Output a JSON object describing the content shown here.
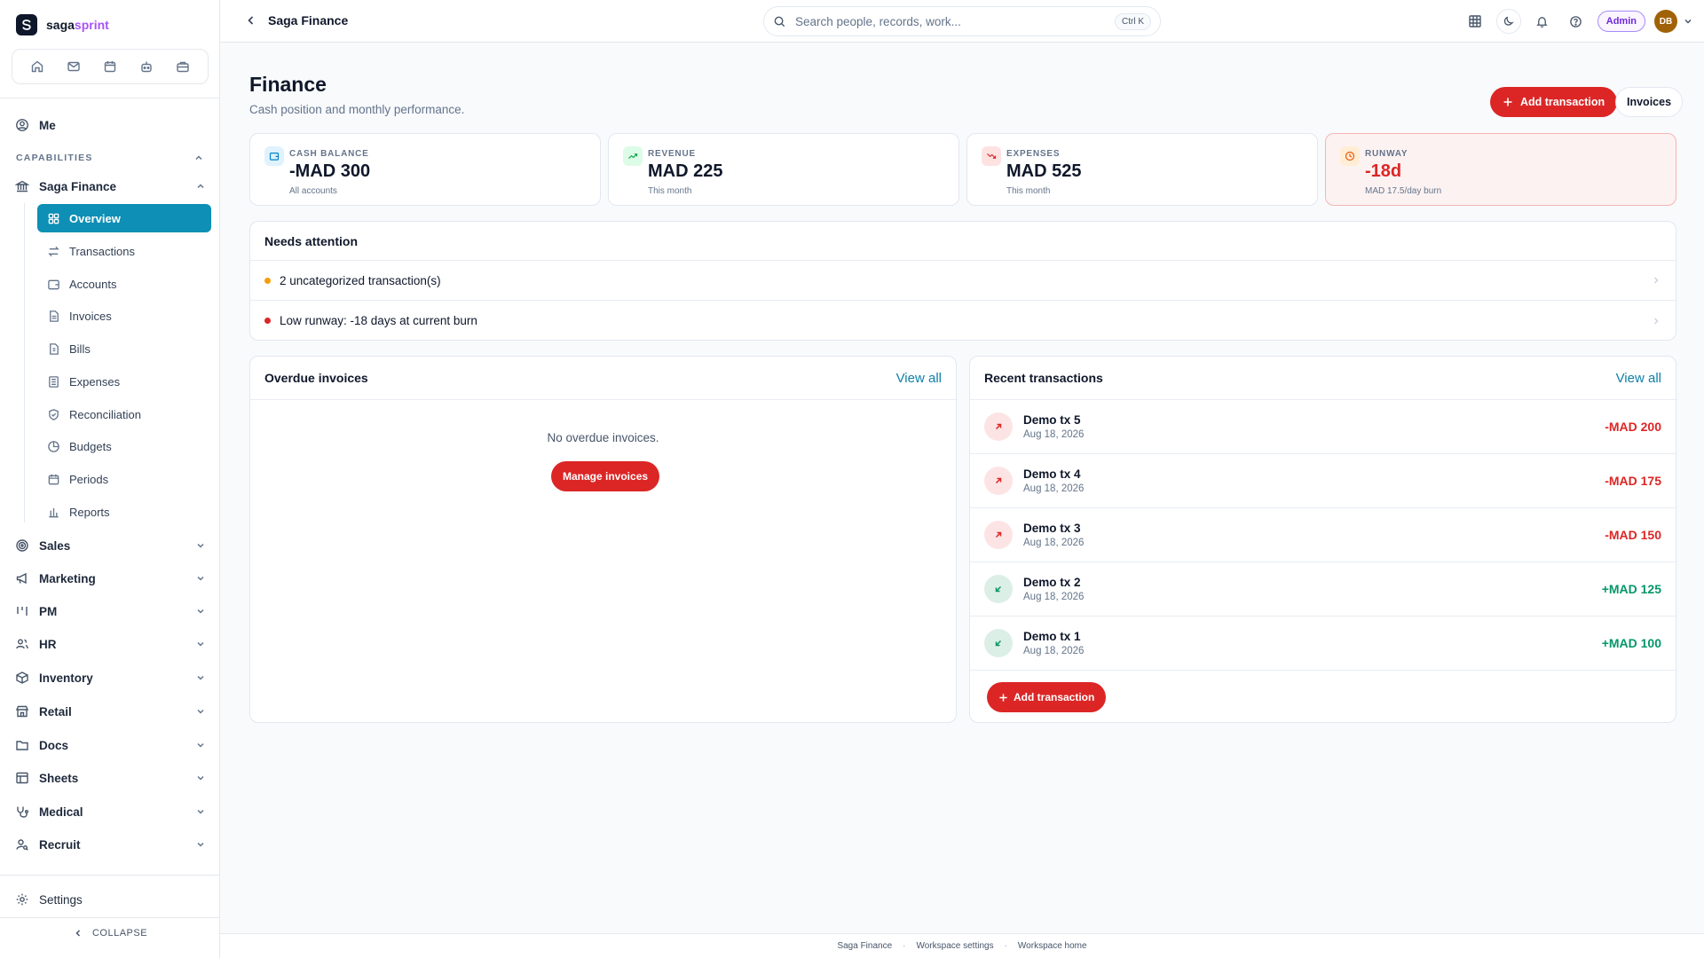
{
  "brand": {
    "name_main": "saga",
    "name_accent": "sprint"
  },
  "sidebar": {
    "me": "Me",
    "capabilities_label": "CAPABILITIES",
    "section": "Saga Finance",
    "sub_items": [
      {
        "label": "Overview",
        "icon": "grid-icon",
        "active": true
      },
      {
        "label": "Transactions",
        "icon": "arrows-swap-icon"
      },
      {
        "label": "Accounts",
        "icon": "wallet-icon"
      },
      {
        "label": "Invoices",
        "icon": "document-icon"
      },
      {
        "label": "Bills",
        "icon": "receipt-icon"
      },
      {
        "label": "Expenses",
        "icon": "list-icon"
      },
      {
        "label": "Reconciliation",
        "icon": "shield-check-icon"
      },
      {
        "label": "Budgets",
        "icon": "pie-icon"
      },
      {
        "label": "Periods",
        "icon": "calendar-icon"
      },
      {
        "label": "Reports",
        "icon": "bar-chart-icon"
      }
    ],
    "groups": [
      {
        "label": "Sales",
        "icon": "target-icon"
      },
      {
        "label": "Marketing",
        "icon": "megaphone-icon"
      },
      {
        "label": "PM",
        "icon": "kanban-icon"
      },
      {
        "label": "HR",
        "icon": "users-icon"
      },
      {
        "label": "Inventory",
        "icon": "box-icon"
      },
      {
        "label": "Retail",
        "icon": "store-icon"
      },
      {
        "label": "Docs",
        "icon": "folder-icon"
      },
      {
        "label": "Sheets",
        "icon": "table-icon"
      },
      {
        "label": "Medical",
        "icon": "stethoscope-icon"
      },
      {
        "label": "Recruit",
        "icon": "user-search-icon"
      }
    ],
    "settings": "Settings",
    "collapse": "COLLAPSE"
  },
  "topbar": {
    "breadcrumb": "Saga Finance",
    "search_placeholder": "Search people, records, work...",
    "search_shortcut": "Ctrl K",
    "role_badge": "Admin",
    "avatar_initials": "DB"
  },
  "page": {
    "title": "Finance",
    "subtitle": "Cash position and monthly performance.",
    "add_transaction": "Add transaction",
    "invoices": "Invoices"
  },
  "kpis": [
    {
      "label": "CASH BALANCE",
      "value": "-MAD 300",
      "note": "All accounts"
    },
    {
      "label": "REVENUE",
      "value": "MAD 225",
      "note": "This month"
    },
    {
      "label": "EXPENSES",
      "value": "MAD 525",
      "note": "This month"
    },
    {
      "label": "RUNWAY",
      "value": "-18d",
      "note": "MAD 17.5/day burn"
    }
  ],
  "attention": {
    "title": "Needs attention",
    "items": [
      {
        "text": "2 uncategorized transaction(s)",
        "color": "#f59e0b"
      },
      {
        "text": "Low runway: -18 days at current burn",
        "color": "#dc2626"
      }
    ]
  },
  "overdue": {
    "title": "Overdue invoices",
    "view_all": "View all",
    "empty": "No overdue invoices.",
    "manage": "Manage invoices"
  },
  "recent": {
    "title": "Recent transactions",
    "view_all": "View all",
    "rows": [
      {
        "name": "Demo tx 5",
        "date": "Aug 18, 2026",
        "amount": "-MAD 200",
        "direction": "out"
      },
      {
        "name": "Demo tx 4",
        "date": "Aug 18, 2026",
        "amount": "-MAD 175",
        "direction": "out"
      },
      {
        "name": "Demo tx 3",
        "date": "Aug 18, 2026",
        "amount": "-MAD 150",
        "direction": "out"
      },
      {
        "name": "Demo tx 2",
        "date": "Aug 18, 2026",
        "amount": "+MAD 125",
        "direction": "in"
      },
      {
        "name": "Demo tx 1",
        "date": "Aug 18, 2026",
        "amount": "+MAD 100",
        "direction": "in"
      }
    ],
    "add_transaction": "Add transaction"
  },
  "footer": {
    "links": [
      "Saga Finance",
      "Workspace settings",
      "Workspace home"
    ]
  },
  "colors": {
    "accent": "#0e8fb5",
    "danger": "#dc2626",
    "success": "#059669",
    "brand_accent": "#a855f7"
  }
}
